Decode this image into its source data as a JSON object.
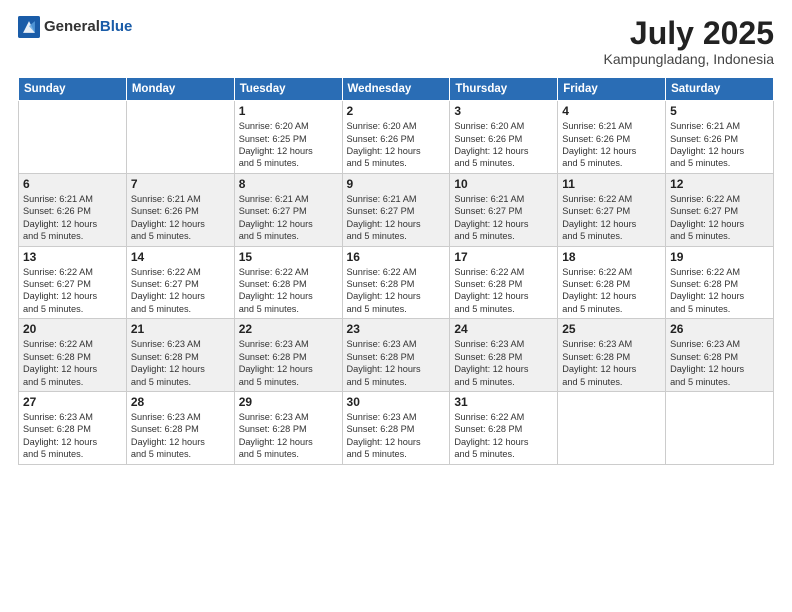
{
  "logo": {
    "text_general": "General",
    "text_blue": "Blue"
  },
  "title": "July 2025",
  "subtitle": "Kampungladang, Indonesia",
  "days_of_week": [
    "Sunday",
    "Monday",
    "Tuesday",
    "Wednesday",
    "Thursday",
    "Friday",
    "Saturday"
  ],
  "weeks": [
    [
      {
        "day": "",
        "info": ""
      },
      {
        "day": "",
        "info": ""
      },
      {
        "day": "1",
        "info": "Sunrise: 6:20 AM\nSunset: 6:25 PM\nDaylight: 12 hours\nand 5 minutes."
      },
      {
        "day": "2",
        "info": "Sunrise: 6:20 AM\nSunset: 6:26 PM\nDaylight: 12 hours\nand 5 minutes."
      },
      {
        "day": "3",
        "info": "Sunrise: 6:20 AM\nSunset: 6:26 PM\nDaylight: 12 hours\nand 5 minutes."
      },
      {
        "day": "4",
        "info": "Sunrise: 6:21 AM\nSunset: 6:26 PM\nDaylight: 12 hours\nand 5 minutes."
      },
      {
        "day": "5",
        "info": "Sunrise: 6:21 AM\nSunset: 6:26 PM\nDaylight: 12 hours\nand 5 minutes."
      }
    ],
    [
      {
        "day": "6",
        "info": "Sunrise: 6:21 AM\nSunset: 6:26 PM\nDaylight: 12 hours\nand 5 minutes."
      },
      {
        "day": "7",
        "info": "Sunrise: 6:21 AM\nSunset: 6:26 PM\nDaylight: 12 hours\nand 5 minutes."
      },
      {
        "day": "8",
        "info": "Sunrise: 6:21 AM\nSunset: 6:27 PM\nDaylight: 12 hours\nand 5 minutes."
      },
      {
        "day": "9",
        "info": "Sunrise: 6:21 AM\nSunset: 6:27 PM\nDaylight: 12 hours\nand 5 minutes."
      },
      {
        "day": "10",
        "info": "Sunrise: 6:21 AM\nSunset: 6:27 PM\nDaylight: 12 hours\nand 5 minutes."
      },
      {
        "day": "11",
        "info": "Sunrise: 6:22 AM\nSunset: 6:27 PM\nDaylight: 12 hours\nand 5 minutes."
      },
      {
        "day": "12",
        "info": "Sunrise: 6:22 AM\nSunset: 6:27 PM\nDaylight: 12 hours\nand 5 minutes."
      }
    ],
    [
      {
        "day": "13",
        "info": "Sunrise: 6:22 AM\nSunset: 6:27 PM\nDaylight: 12 hours\nand 5 minutes."
      },
      {
        "day": "14",
        "info": "Sunrise: 6:22 AM\nSunset: 6:27 PM\nDaylight: 12 hours\nand 5 minutes."
      },
      {
        "day": "15",
        "info": "Sunrise: 6:22 AM\nSunset: 6:28 PM\nDaylight: 12 hours\nand 5 minutes."
      },
      {
        "day": "16",
        "info": "Sunrise: 6:22 AM\nSunset: 6:28 PM\nDaylight: 12 hours\nand 5 minutes."
      },
      {
        "day": "17",
        "info": "Sunrise: 6:22 AM\nSunset: 6:28 PM\nDaylight: 12 hours\nand 5 minutes."
      },
      {
        "day": "18",
        "info": "Sunrise: 6:22 AM\nSunset: 6:28 PM\nDaylight: 12 hours\nand 5 minutes."
      },
      {
        "day": "19",
        "info": "Sunrise: 6:22 AM\nSunset: 6:28 PM\nDaylight: 12 hours\nand 5 minutes."
      }
    ],
    [
      {
        "day": "20",
        "info": "Sunrise: 6:22 AM\nSunset: 6:28 PM\nDaylight: 12 hours\nand 5 minutes."
      },
      {
        "day": "21",
        "info": "Sunrise: 6:23 AM\nSunset: 6:28 PM\nDaylight: 12 hours\nand 5 minutes."
      },
      {
        "day": "22",
        "info": "Sunrise: 6:23 AM\nSunset: 6:28 PM\nDaylight: 12 hours\nand 5 minutes."
      },
      {
        "day": "23",
        "info": "Sunrise: 6:23 AM\nSunset: 6:28 PM\nDaylight: 12 hours\nand 5 minutes."
      },
      {
        "day": "24",
        "info": "Sunrise: 6:23 AM\nSunset: 6:28 PM\nDaylight: 12 hours\nand 5 minutes."
      },
      {
        "day": "25",
        "info": "Sunrise: 6:23 AM\nSunset: 6:28 PM\nDaylight: 12 hours\nand 5 minutes."
      },
      {
        "day": "26",
        "info": "Sunrise: 6:23 AM\nSunset: 6:28 PM\nDaylight: 12 hours\nand 5 minutes."
      }
    ],
    [
      {
        "day": "27",
        "info": "Sunrise: 6:23 AM\nSunset: 6:28 PM\nDaylight: 12 hours\nand 5 minutes."
      },
      {
        "day": "28",
        "info": "Sunrise: 6:23 AM\nSunset: 6:28 PM\nDaylight: 12 hours\nand 5 minutes."
      },
      {
        "day": "29",
        "info": "Sunrise: 6:23 AM\nSunset: 6:28 PM\nDaylight: 12 hours\nand 5 minutes."
      },
      {
        "day": "30",
        "info": "Sunrise: 6:23 AM\nSunset: 6:28 PM\nDaylight: 12 hours\nand 5 minutes."
      },
      {
        "day": "31",
        "info": "Sunrise: 6:22 AM\nSunset: 6:28 PM\nDaylight: 12 hours\nand 5 minutes."
      },
      {
        "day": "",
        "info": ""
      },
      {
        "day": "",
        "info": ""
      }
    ]
  ]
}
